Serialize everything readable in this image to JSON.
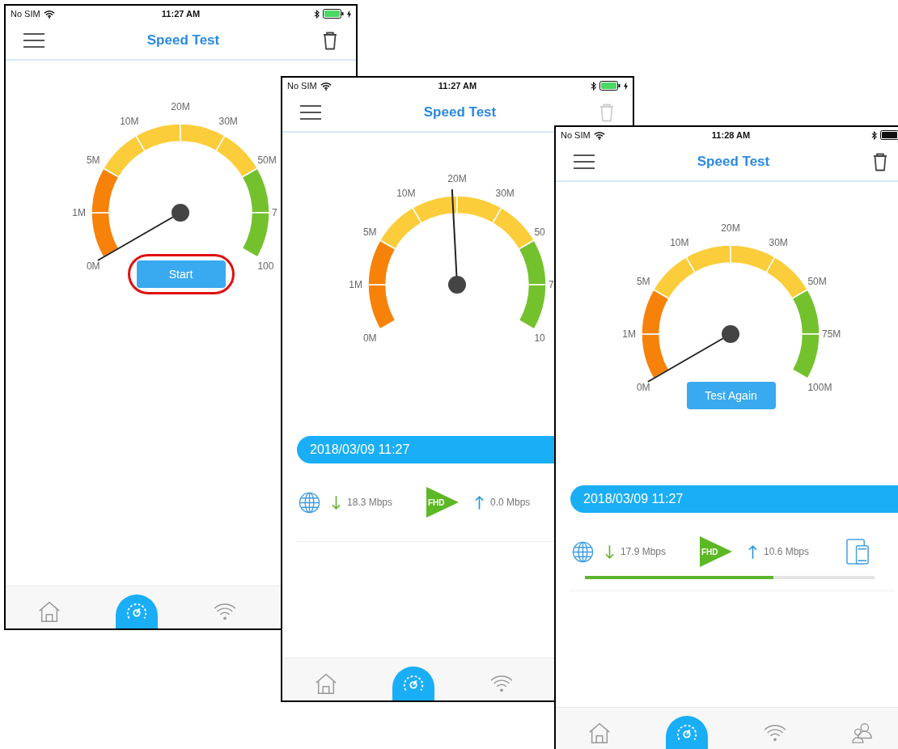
{
  "screens": [
    {
      "status_bar": {
        "carrier": "No SIM",
        "time": "11:27 AM",
        "charging": true
      },
      "header": {
        "title": "Speed Test",
        "delete_disabled": false
      },
      "gauge": {
        "labels": [
          "0M",
          "1M",
          "5M",
          "10M",
          "20M",
          "30M",
          "50M",
          "7",
          "100"
        ]
      },
      "action_button": {
        "label": "Start",
        "highlighted": true
      },
      "nav": [
        {
          "kind": "home",
          "selected": false
        },
        {
          "kind": "speed",
          "selected": true
        },
        {
          "kind": "wifi",
          "selected": false
        }
      ]
    },
    {
      "status_bar": {
        "carrier": "No SIM",
        "time": "11:27 AM",
        "charging": true
      },
      "header": {
        "title": "Speed Test",
        "delete_disabled": true
      },
      "gauge": {
        "labels": [
          "0M",
          "1M",
          "5M",
          "10M",
          "20M",
          "30M",
          "50",
          "7",
          "10"
        ]
      },
      "result": {
        "date": "2018/03/09 11:27",
        "download": "18.3 Mbps",
        "badge": "FHD",
        "upload": "0.0 Mbps"
      },
      "nav": [
        {
          "kind": "home",
          "selected": false
        },
        {
          "kind": "speed",
          "selected": true
        },
        {
          "kind": "wifi",
          "selected": false
        }
      ]
    },
    {
      "status_bar": {
        "carrier": "No SIM",
        "time": "11:28 AM",
        "charging": false
      },
      "header": {
        "title": "Speed Test",
        "delete_disabled": false
      },
      "gauge": {
        "labels": [
          "0M",
          "1M",
          "5M",
          "10M",
          "20M",
          "30M",
          "50M",
          "75M",
          "100M"
        ]
      },
      "action_button": {
        "label": "Test Again"
      },
      "result": {
        "date": "2018/03/09 11:27",
        "download": "17.9 Mbps",
        "badge": "FHD",
        "upload": "10.6 Mbps",
        "device": true,
        "level": 0.65
      },
      "nav": [
        {
          "kind": "home",
          "selected": false
        },
        {
          "kind": "speed",
          "selected": true
        },
        {
          "kind": "wifi",
          "selected": false
        },
        {
          "kind": "people",
          "selected": false
        }
      ]
    }
  ]
}
